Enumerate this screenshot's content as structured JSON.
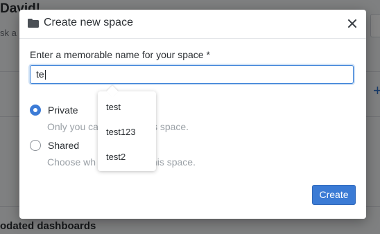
{
  "background": {
    "greeting": "David!",
    "subtitle": "sk a",
    "section_title": "odated dashboards"
  },
  "modal": {
    "title": "Create new space",
    "close_symbol": "✕",
    "name_label": "Enter a memorable name for your space",
    "required_marker": "*",
    "name_value": "te",
    "visibility_options": [
      {
        "label": "Private",
        "help": "Only you can access this space.",
        "visible_help_left": "Only you ca",
        "visible_help_right": "s space.",
        "checked": true
      },
      {
        "label": "Shared",
        "help": "Choose who can access this space.",
        "visible_help_left": "Choose wh",
        "visible_help_right": "this space.",
        "checked": false
      }
    ],
    "create_label": "Create"
  },
  "autocomplete": {
    "suggestions": [
      "test",
      "test123",
      "test2"
    ]
  },
  "colors": {
    "accent": "#3b7bd5",
    "overlay": "rgba(0,0,0,0.48)"
  },
  "icons": {
    "header": "folder-icon",
    "close": "close-icon"
  }
}
